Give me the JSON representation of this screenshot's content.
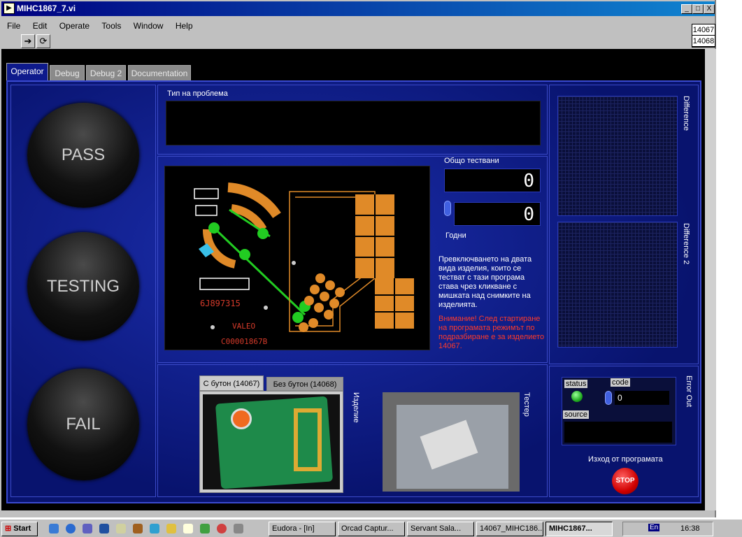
{
  "window": {
    "title": "MIHC1867_7.vi",
    "min": "_",
    "max": "□",
    "close": "X"
  },
  "menu": [
    "File",
    "Edit",
    "Operate",
    "Tools",
    "Window",
    "Help"
  ],
  "instances": [
    "14067",
    "14068"
  ],
  "tabs": [
    "Operator",
    "Debug",
    "Debug 2",
    "Documentation"
  ],
  "lamps": {
    "pass": "PASS",
    "testing": "TESTING",
    "fail": "FAIL"
  },
  "problem": {
    "label": "Тип на проблема",
    "value": ""
  },
  "counters": {
    "total_label": "Общо тествани",
    "total": "0",
    "good": "0",
    "good_label": "Годни"
  },
  "info_text": "Превключването на двата вида изделия, които  се тестват с тази програма става чрез кликване с мишката над снимките  на изделията.",
  "warning_text": "Внимание!  След стартиране на програмата режимът по подразбиране е за изделието 14067.",
  "diff_labels": [
    "Difference",
    "Difference 2"
  ],
  "pcb_labels": {
    "part": "6J897315",
    "brand": "VALEO",
    "code": "C00001867B"
  },
  "product_tabs": [
    "С бутон (14067)",
    "Без бутон (14068)"
  ],
  "product_label": "Изделие",
  "tester_label": "Тестер",
  "error": {
    "label": "Error Out",
    "status": "status",
    "code": "code",
    "code_value": "0",
    "source": "source",
    "source_value": ""
  },
  "exit": {
    "label": "Изход от програмата",
    "stop": "STOP"
  },
  "taskbar": {
    "start": "Start",
    "items": [
      "Eudora - [In]",
      "Orcad Captur...",
      "Servant Sala...",
      "14067_MIHC186...",
      "MIHC1867..."
    ],
    "clock": "16:38",
    "lang": "En"
  },
  "colors": {
    "pcb_copper": "#e08a28",
    "pcb_trace": "#22cc22",
    "panel_blue": "#0e1a8c"
  }
}
